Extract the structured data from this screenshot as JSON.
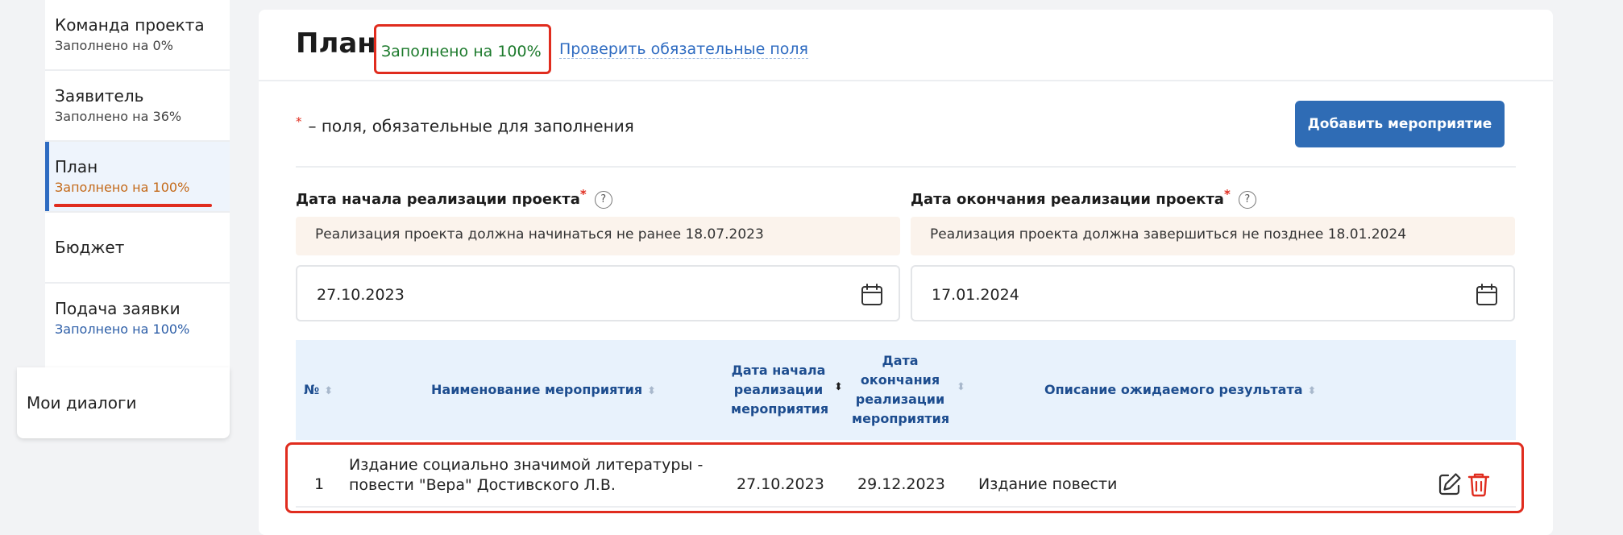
{
  "sidebar": {
    "items": [
      {
        "title": "Команда проекта",
        "sub": "Заполнено на 0%"
      },
      {
        "title": "Заявитель",
        "sub": "Заполнено на 36%"
      },
      {
        "title": "План",
        "sub": "Заполнено на 100%"
      },
      {
        "title": "Бюджет",
        "sub": ""
      },
      {
        "title": "Подача заявки",
        "sub": "Заполнено на 100%"
      }
    ],
    "dialogs": "Мои диалоги"
  },
  "header": {
    "title": "План",
    "fill_status": "Заполнено на 100%",
    "check_link": "Проверить обязательные поля"
  },
  "form": {
    "required_note": "– поля, обязательные для заполнения",
    "required_star": "*",
    "add_button": "Добавить мероприятие",
    "start": {
      "label": "Дата начала реализации проекта",
      "hint": "Реализация проекта должна начинаться не ранее 18.07.2023",
      "value": "27.10.2023"
    },
    "end": {
      "label": "Дата окончания реализации проекта",
      "hint": "Реализация проекта должна завершиться не позднее 18.01.2024",
      "value": "17.01.2024"
    },
    "help_glyph": "?"
  },
  "table": {
    "headers": {
      "num": "№",
      "name": "Наименование мероприятия",
      "start": [
        "Дата начала",
        "реализации",
        "мероприятия"
      ],
      "end": [
        "Дата",
        "окончания",
        "реализации",
        "мероприятия"
      ],
      "desc": "Описание ожидаемого результата"
    },
    "rows": [
      {
        "num": "1",
        "name_line1": "Издание социально значимой литературы -",
        "name_line2": "повести \"Вера\" Достивского Л.В.",
        "start": "27.10.2023",
        "end": "29.12.2023",
        "desc": "Издание повести"
      }
    ]
  },
  "colors": {
    "accent": "#2f6cb5",
    "highlight_red": "#e02c1e",
    "success_green": "#1c7a2c",
    "progress_orange": "#c46a1a"
  }
}
